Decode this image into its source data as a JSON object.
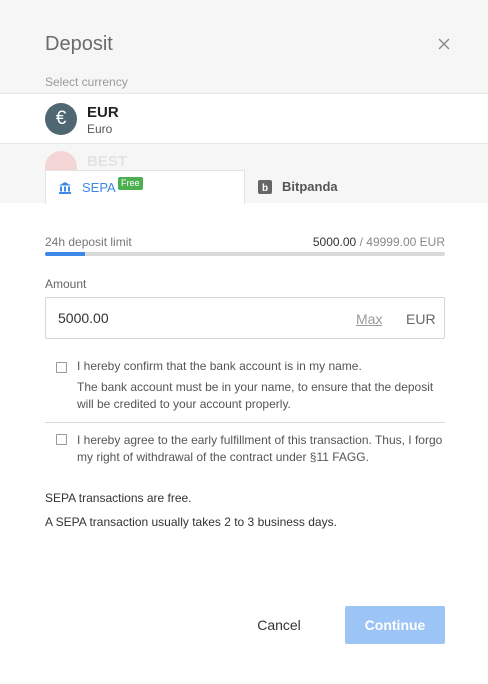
{
  "dialog": {
    "title": "Deposit",
    "close_icon": "close-icon",
    "select_currency_label": "Select currency"
  },
  "currencies": [
    {
      "code": "EUR",
      "name": "Euro",
      "icon_glyph": "€",
      "icon": "euro-coin-icon",
      "color": "#4f6772",
      "selected": true
    },
    {
      "code": "BEST",
      "partially_visible": true
    }
  ],
  "tabs": [
    {
      "label": "SEPA",
      "badge": "Free",
      "icon": "bank-icon",
      "active": true,
      "accent": "#3d88e8"
    },
    {
      "label": "Bitpanda",
      "icon": "bitpanda-logo-icon",
      "active": false
    }
  ],
  "limit": {
    "label": "24h deposit limit",
    "current": "5000.00",
    "separator": "/",
    "max": "49999.00 EUR",
    "progress_fraction": 0.1
  },
  "amount": {
    "label": "Amount",
    "value": "5000.00",
    "max_label": "Max",
    "currency": "EUR"
  },
  "confirmations": [
    {
      "text": "I hereby confirm that the bank account is in my name.",
      "subtext": "The bank account must be in your name, to ensure that the deposit will be credited to your account properly.",
      "checked": false
    },
    {
      "text": "I hereby agree to the early fulfillment of this transaction. Thus, I forgo my right of withdrawal of the contract under §11 FAGG.",
      "checked": false
    }
  ],
  "info": [
    "SEPA transactions are free.",
    "A SEPA transaction usually takes 2 to 3 business days."
  ],
  "actions": {
    "cancel_label": "Cancel",
    "continue_label": "Continue",
    "continue_color": "#9cc4f4"
  }
}
